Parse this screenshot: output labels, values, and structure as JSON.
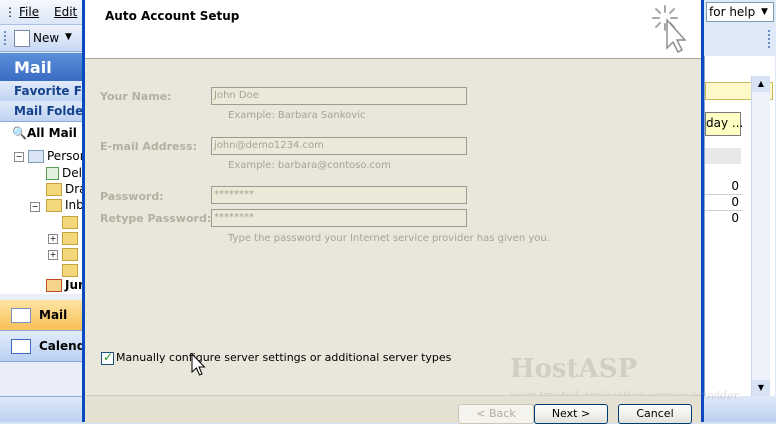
{
  "outlook": {
    "menu": {
      "file": "File",
      "edit": "Edit"
    },
    "toolbar": {
      "new_label": "New"
    },
    "nav": {
      "title": "Mail",
      "favorite_folders": "Favorite Folders",
      "mail_folders": "Mail Folders",
      "all_mail_items": "All Mail Items",
      "tree": [
        {
          "label": "Personal Folders"
        },
        {
          "label": "Deleted Items"
        },
        {
          "label": "Drafts"
        },
        {
          "label": "Inbox"
        },
        {
          "label": ""
        },
        {
          "label": ""
        },
        {
          "label": ""
        },
        {
          "label": ""
        },
        {
          "label": "Junk E-mail"
        }
      ],
      "buttons": {
        "mail": "Mail",
        "calendar": "Calendar"
      }
    },
    "right": {
      "help_placeholder": "for help",
      "today_label": "day ...",
      "counts": [
        "0",
        "0",
        "0"
      ]
    }
  },
  "dialog": {
    "title": "Auto Account Setup",
    "fields": {
      "name_label": "Your Name:",
      "name_value": "John Doe",
      "name_hint": "Example: Barbara Sankovic",
      "email_label": "E-mail Address:",
      "email_value": "john@demo1234.com",
      "email_hint": "Example: barbara@contoso.com",
      "password_label": "Password:",
      "password_value": "********",
      "retype_label": "Retype Password:",
      "retype_value": "********",
      "password_hint": "Type the password your Internet service provider has given you."
    },
    "manual_config_label": "Manually configure server settings or additional server types",
    "manual_config_checked": true,
    "watermark": {
      "brand": "HostASP",
      "tagline": "your trusted application service provider"
    },
    "buttons": {
      "back": "< Back",
      "next": "Next >",
      "cancel": "Cancel"
    }
  },
  "colors": {
    "dialog_border": "#0a49c0",
    "body_bg": "#e9e7db",
    "disabled_text": "#b3b09f",
    "check_mark": "#21a121"
  }
}
